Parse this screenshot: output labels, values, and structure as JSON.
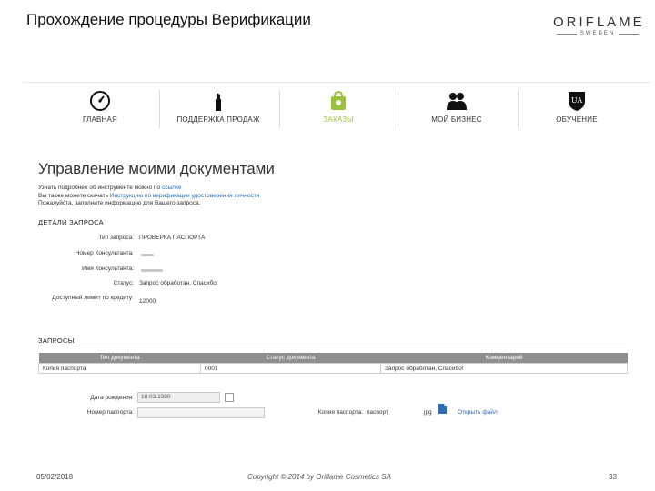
{
  "slide": {
    "title": "Прохождение процедуры Верификации",
    "logo_main": "ORIFLAME",
    "logo_sub": "SWEDEN",
    "footer_date": "05/02/2018",
    "footer_copyright": "Copyright © 2014 by Oriflame Cosmetics SA",
    "footer_page": "33"
  },
  "nav": {
    "items": [
      {
        "label": "ГЛАВНАЯ",
        "icon": "speedometer-icon"
      },
      {
        "label": "ПОДДЕРЖКА ПРОДАЖ",
        "icon": "lipstick-icon"
      },
      {
        "label": "ЗАКАЗЫ",
        "icon": "shopping-bag-icon",
        "active": true
      },
      {
        "label": "МОЙ БИЗНЕС",
        "icon": "people-icon"
      },
      {
        "label": "ОБУЧЕНИЕ",
        "icon": "university-shield-icon"
      }
    ],
    "active_color": "#9ac23c"
  },
  "page": {
    "heading": "Управление моими документами",
    "intro_line1_prefix": "Узнать подробнее об инструменте можно по ",
    "intro_line1_link": "ссылке",
    "intro_line2_prefix": "Вы также можете скачать ",
    "intro_line2_link": "Инструкцию по верификации удостоверения личности",
    "intro_line3": "Пожалуйста, заполните информацию для Вашего запроса."
  },
  "request_details": {
    "heading": "ДЕТАЛИ ЗАПРОСА",
    "fields": [
      {
        "label": "Тип запроса:",
        "value": "ПРОВЕРКА ПАСПОРТА"
      },
      {
        "label": "Номер Консультанта:",
        "value": ""
      },
      {
        "label": "Имя Консультанта:",
        "value": ""
      },
      {
        "label": "Статус:",
        "value": "Запрос обработан, Спасибо!"
      },
      {
        "label": "Доступный лимит по кредиту:",
        "value": "12000"
      }
    ]
  },
  "requests": {
    "heading": "ЗАПРОСЫ",
    "columns": [
      "Тип документа",
      "Статус документа",
      "Комментарий"
    ],
    "rows": [
      [
        "Копия паспорта",
        "0001",
        "Запрос обработан, Спасибо!"
      ]
    ]
  },
  "form": {
    "birth_label": "Дата рождения:",
    "birth_value": "18.03.1980",
    "passport_label": "Номер паспорта:",
    "passport_value": "",
    "copy_label": "Копия паспорта:",
    "copy_value": "паспорт",
    "file_ext": "jpg",
    "open_file": "Открыть файл"
  }
}
